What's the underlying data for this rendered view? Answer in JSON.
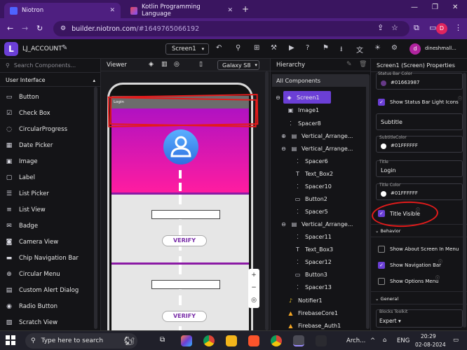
{
  "browser": {
    "tabs": [
      {
        "label": "Niotron",
        "active": true
      },
      {
        "label": "Kotlin Programming Language",
        "active": false
      }
    ],
    "new_tab": "+",
    "url_host": "builder.niotron.com",
    "url_rest": "/#1649765066192",
    "profile_initial": "D"
  },
  "app": {
    "project_name": "LJ_ACCOUNT",
    "screen_select": "Screen1",
    "user_initial": "d",
    "user_name": "dineshmall..."
  },
  "palette": {
    "search_placeholder": "Search Components...",
    "category": "User Interface",
    "items": [
      "Button",
      "Check Box",
      "CircularProgress",
      "Date Picker",
      "Image",
      "Label",
      "List Picker",
      "List View",
      "Badge",
      "Camera View",
      "Chip Navigation Bar",
      "Circular Menu",
      "Custom Alert Dialog",
      "Radio Button",
      "Scratch View"
    ]
  },
  "viewer": {
    "title": "Viewer",
    "device": "Galaxy S8",
    "title_bar_text": "Login",
    "button_label": "VERIFY"
  },
  "hierarchy": {
    "title": "Hierarchy",
    "root": "All Components",
    "items": [
      {
        "label": "Screen1",
        "icon": "layers-icon",
        "selected": true
      },
      {
        "label": "Image1",
        "icon": "image-icon"
      },
      {
        "label": "Spacer8",
        "icon": "spacer-icon"
      },
      {
        "label": "Vertical_Arrange...",
        "icon": "vertical-arrangement-icon"
      },
      {
        "label": "Vertical_Arrange...",
        "icon": "vertical-arrangement-icon"
      },
      {
        "label": "Spacer6",
        "icon": "spacer-icon"
      },
      {
        "label": "Text_Box2",
        "icon": "textbox-icon"
      },
      {
        "label": "Spacer10",
        "icon": "spacer-icon"
      },
      {
        "label": "Button2",
        "icon": "button-icon"
      },
      {
        "label": "Spacer5",
        "icon": "spacer-icon"
      },
      {
        "label": "Vertical_Arrange...",
        "icon": "vertical-arrangement-icon"
      },
      {
        "label": "Spacer11",
        "icon": "spacer-icon"
      },
      {
        "label": "Text_Box3",
        "icon": "textbox-icon"
      },
      {
        "label": "Spacer12",
        "icon": "spacer-icon"
      },
      {
        "label": "Button3",
        "icon": "button-icon"
      },
      {
        "label": "Spacer13",
        "icon": "spacer-icon"
      },
      {
        "label": "Notifier1",
        "icon": "bell-icon"
      },
      {
        "label": "FirebaseCore1",
        "icon": "firebase-icon"
      },
      {
        "label": "Firebase_Auth1",
        "icon": "firebase-icon"
      }
    ]
  },
  "properties": {
    "title": "Screen1 (Screen) Properties",
    "status_bar_color_label": "Status Bar Color",
    "status_bar_color_value": "#01663987",
    "show_status_bar_light_icons": "Show Status Bar Light Icons",
    "subtitle_value": "Subtitle",
    "subtitle_color_label": "SubtitleColor",
    "subtitle_color_value": "#01FFFFFF",
    "title_label": "Title",
    "title_value": "Login",
    "title_color_label": "Title Color",
    "title_color_value": "#01FFFFFF",
    "title_visible": "Title Visible",
    "behavior_section": "Behavior",
    "show_about_screen": "Show About Screen In Menu",
    "show_navigation_bar": "Show Navigation Bar",
    "show_options_menu": "Show Options Menu",
    "general_section": "General",
    "blocks_toolkit_label": "Blocks Toolkit",
    "blocks_toolkit_value": "Expert"
  },
  "taskbar": {
    "search_placeholder": "Type here to search",
    "arch_label": "Arch...",
    "lang": "ENG",
    "time": "20:29",
    "date": "02-08-2024"
  },
  "colors": {
    "accent": "#6b3fd6",
    "annotation": "#e31b1b",
    "status_bar_swatch": "#663987"
  }
}
